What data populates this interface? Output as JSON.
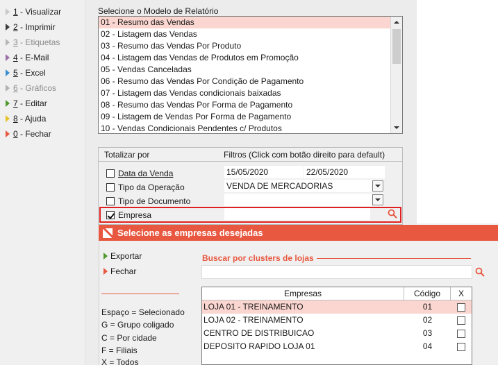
{
  "sidebar": {
    "items": [
      {
        "key": "1",
        "text": " - Visualizar",
        "disabled": false,
        "color": "#9e9e9e"
      },
      {
        "key": "2",
        "text": " - Imprimir",
        "disabled": false,
        "color": "#3a3a3a"
      },
      {
        "key": "3",
        "text": " - Etiquetas",
        "disabled": true,
        "color": "#9e9e9e"
      },
      {
        "key": "4",
        "text": " - E-Mail",
        "disabled": false,
        "color": "#9c6fa8"
      },
      {
        "key": "5",
        "text": " - Excel",
        "disabled": false,
        "color": "#3b8fd0"
      },
      {
        "key": "6",
        "text": " - Gráficos",
        "disabled": true,
        "color": "#a0a0a0"
      },
      {
        "key": "7",
        "text": " - Editar",
        "disabled": false,
        "color": "#4e9a2f"
      },
      {
        "key": "8",
        "text": " - Ajuda",
        "disabled": false,
        "color": "#e6c229"
      },
      {
        "key": "0",
        "text": " - Fechar",
        "disabled": false,
        "color": "#e8573f"
      }
    ]
  },
  "report": {
    "title": "Selecione o Modelo de Relatório",
    "items": [
      "01 - Resumo das Vendas",
      "02 - Listagem das Vendas",
      "03 - Resumo das Vendas Por Produto",
      "04 - Listagem das Vendas de Produtos em Promoção",
      "05 - Vendas Canceladas",
      "06 - Resumo das Vendas Por Condição de Pagamento",
      "07 - Listagem das Vendas condicionais baixadas",
      "08 - Resumo das Vendas Por Forma de Pagamento",
      "09 - Listagem de Vendas Por Forma de Pagamento",
      "10 - Vendas Condicionais Pendentes c/ Produtos"
    ]
  },
  "filters": {
    "header_totalizar": "Totalizar por",
    "header_filtros": "Filtros (Click com botão direito para default)",
    "data_venda_label": "Data da Venda",
    "data_inicio": "15/05/2020",
    "data_fim": "22/05/2020",
    "tipo_operacao_label": "Tipo da Operação",
    "tipo_operacao_value": "VENDA DE MERCADORIAS",
    "tipo_documento_label": "Tipo de Documento",
    "empresa_label": "Empresa"
  },
  "popup": {
    "title": "Selecione as empresas desejadas",
    "exportar": "Exportar",
    "fechar": "Fechar",
    "legend": [
      "Espaço = Selecionado",
      "G = Grupo coligado",
      "C = Por cidade",
      "F = Filiais",
      "X = Todos"
    ],
    "busca_label": "Buscar por clusters de lojas",
    "grid_headers": {
      "empresas": "Empresas",
      "codigo": "Código",
      "x": "X"
    },
    "rows": [
      {
        "nome": "LOJA 01 - TREINAMENTO",
        "codigo": "01"
      },
      {
        "nome": "LOJA 02 - TREINAMENTO",
        "codigo": "02"
      },
      {
        "nome": "CENTRO DE DISTRIBUICAO",
        "codigo": "03"
      },
      {
        "nome": "DEPOSITO RAPIDO LOJA 01",
        "codigo": "04"
      }
    ]
  },
  "colors": {
    "accent": "#e8573f",
    "selection": "#fbd6d0",
    "highlight_border": "#e02020"
  }
}
